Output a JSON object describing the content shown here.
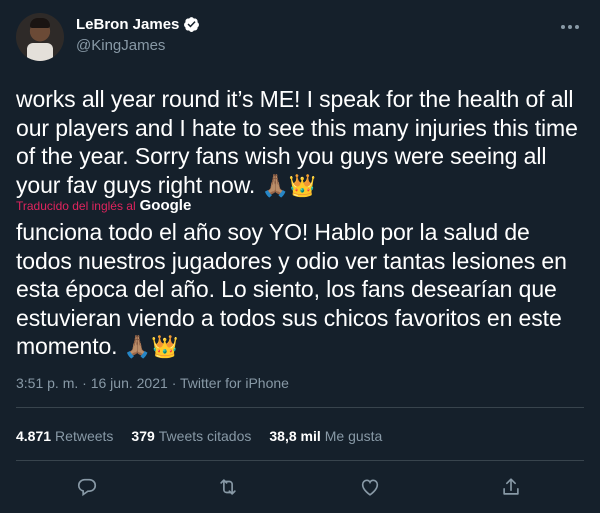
{
  "author": {
    "display_name": "LeBron James",
    "handle": "@KingJames",
    "verified": true
  },
  "tweet": {
    "text": "works all year round it’s ME! I speak for the health of all our players and I hate to see this many injuries this time of the year. Sorry fans wish you guys were seeing all your fav guys right now.",
    "emojis": "🙏🏽👑",
    "translated_label": "Traducido del inglés al",
    "translator": "Google",
    "translation": "funciona todo el año soy YO! Hablo por la salud de todos nuestros jugadores y odio ver tantas lesiones en esta época del año. Lo siento, los fans desearían que estuvieran viendo a todos sus chicos favoritos en este momento.",
    "translation_emojis": "🙏🏽👑",
    "time": "3:51 p. m.",
    "date": "16 jun. 2021",
    "source": "Twitter for iPhone"
  },
  "stats": {
    "retweets_count": "4.871",
    "retweets_label": "Retweets",
    "quotes_count": "379",
    "quotes_label": "Tweets citados",
    "likes_count": "38,8 mil",
    "likes_label": "Me gusta"
  },
  "icons": {
    "reply": "reply-icon",
    "retweet": "retweet-icon",
    "like": "heart-icon",
    "share": "share-icon",
    "more": "more-icon",
    "verified": "verified-badge-icon"
  },
  "colors": {
    "background": "#15202b",
    "secondary_text": "#8899a6",
    "accent": "#1da1f2",
    "translation_link": "#e0245e"
  }
}
